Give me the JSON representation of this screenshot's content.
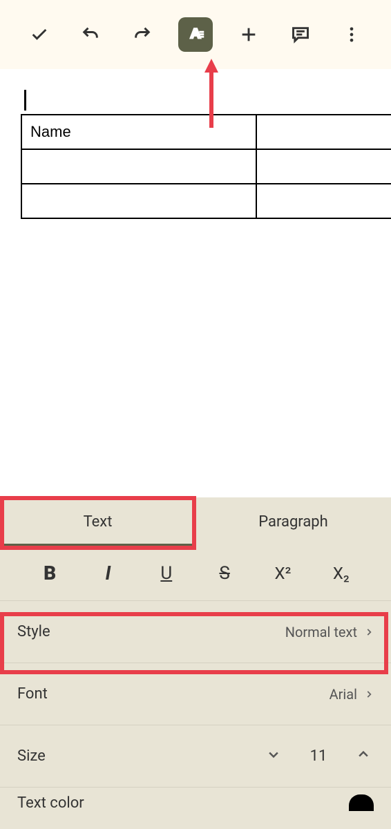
{
  "toolbar": {
    "done_label": "Done",
    "undo_label": "Undo",
    "redo_label": "Redo",
    "format_label": "Format",
    "insert_label": "Insert",
    "comment_label": "Comment",
    "more_label": "More"
  },
  "document": {
    "table": {
      "rows": [
        [
          "Name",
          ""
        ],
        [
          "",
          ""
        ],
        [
          "",
          ""
        ]
      ]
    }
  },
  "panel": {
    "tabs": {
      "text": "Text",
      "paragraph": "Paragraph"
    },
    "format_buttons": {
      "bold": "B",
      "italic": "I",
      "underline": "U",
      "strikethrough": "S",
      "superscript": "X²",
      "subscript": "X₂"
    },
    "style": {
      "label": "Style",
      "value": "Normal text"
    },
    "font": {
      "label": "Font",
      "value": "Arial"
    },
    "size": {
      "label": "Size",
      "value": "11"
    },
    "text_color": {
      "label": "Text color"
    }
  }
}
